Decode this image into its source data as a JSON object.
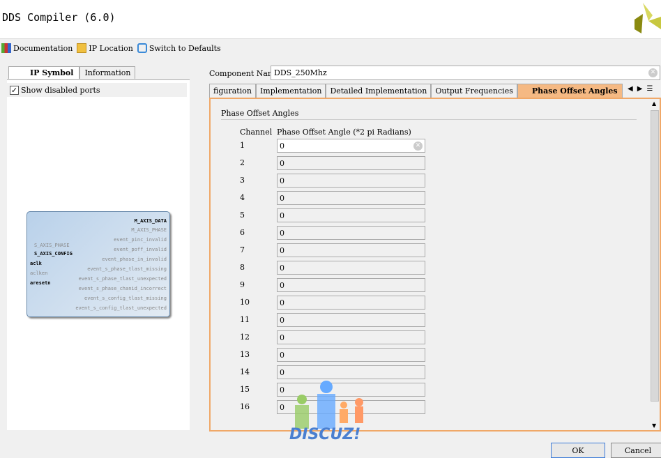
{
  "window": {
    "title": "DDS Compiler (6.0)"
  },
  "toolbar": {
    "documentation": "Documentation",
    "ip_location": "IP Location",
    "switch_defaults": "Switch to Defaults"
  },
  "left": {
    "tabs": [
      "IP Symbol",
      "Information"
    ],
    "show_disabled": "Show disabled ports",
    "symbol": {
      "right_ports": [
        "M_AXIS_DATA",
        "M_AXIS_PHASE",
        "event_pinc_invalid",
        "event_poff_invalid",
        "event_phase_in_invalid",
        "event_s_phase_tlast_missing",
        "event_s_phase_tlast_unexpected",
        "event_s_phase_chanid_incorrect",
        "event_s_config_tlast_missing",
        "event_s_config_tlast_unexpected"
      ],
      "left_ports": [
        "S_AXIS_PHASE",
        "S_AXIS_CONFIG",
        "aclk",
        "aclken",
        "aresetn"
      ]
    }
  },
  "component": {
    "label": "Component Name",
    "value": "DDS_250Mhz"
  },
  "tabs": [
    "figuration",
    "Implementation",
    "Detailed Implementation",
    "Output Frequencies",
    "Phase Offset Angles"
  ],
  "panel": {
    "section": "Phase Offset Angles",
    "col_channel": "Channel",
    "col_angle": "Phase Offset Angle (*2 pi Radians)",
    "rows": [
      {
        "ch": "1",
        "v": "0"
      },
      {
        "ch": "2",
        "v": "0"
      },
      {
        "ch": "3",
        "v": "0"
      },
      {
        "ch": "4",
        "v": "0"
      },
      {
        "ch": "5",
        "v": "0"
      },
      {
        "ch": "6",
        "v": "0"
      },
      {
        "ch": "7",
        "v": "0"
      },
      {
        "ch": "8",
        "v": "0"
      },
      {
        "ch": "9",
        "v": "0"
      },
      {
        "ch": "10",
        "v": "0"
      },
      {
        "ch": "11",
        "v": "0"
      },
      {
        "ch": "12",
        "v": "0"
      },
      {
        "ch": "13",
        "v": "0"
      },
      {
        "ch": "14",
        "v": "0"
      },
      {
        "ch": "15",
        "v": "0"
      },
      {
        "ch": "16",
        "v": "0"
      }
    ]
  },
  "buttons": {
    "ok": "OK",
    "cancel": "Cancel"
  },
  "watermark": "DISCUZ!"
}
